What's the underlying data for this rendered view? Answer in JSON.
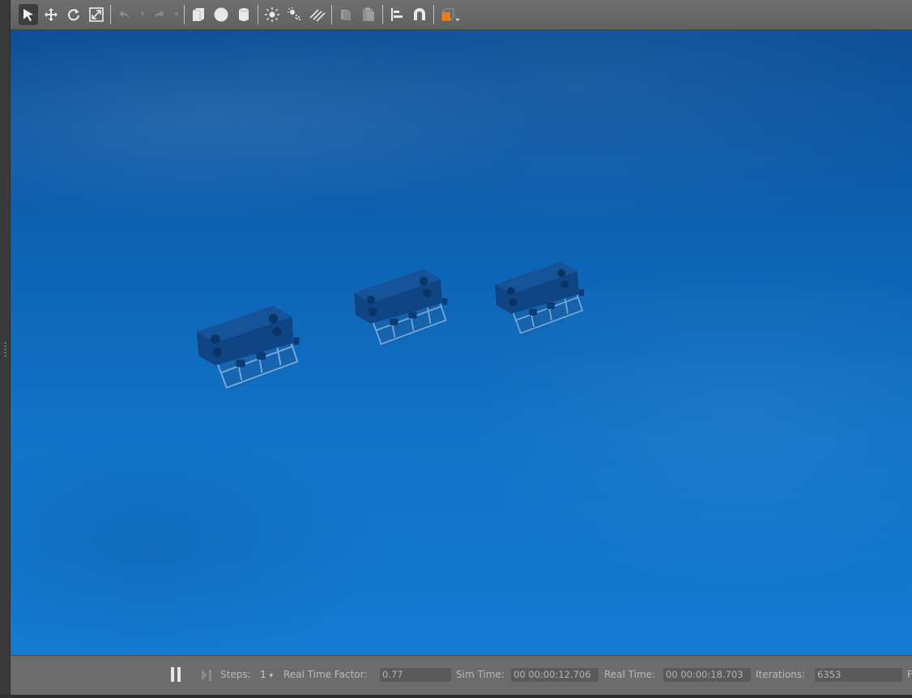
{
  "toolbar": {
    "icons": [
      "select-arrow-icon",
      "translate-icon",
      "rotate-icon",
      "scale-icon",
      "undo-icon",
      "undo-dropdown-icon",
      "redo-icon",
      "redo-dropdown-icon",
      "box-icon",
      "sphere-icon",
      "cylinder-icon",
      "point-light-icon",
      "spot-light-icon",
      "directional-light-icon",
      "copy-icon",
      "paste-icon",
      "align-icon",
      "snap-icon",
      "view-angle-icon"
    ],
    "accent_color": "#f07c14"
  },
  "viewport": {
    "models": [
      "model-1",
      "model-2",
      "model-3"
    ],
    "water_color": "#0e63b4"
  },
  "statusbar": {
    "steps_label": "Steps:",
    "steps_value": "1",
    "rtf_label": "Real Time Factor:",
    "rtf_value": "0.77",
    "sim_time_label": "Sim Time:",
    "sim_time_value": "00 00:00:12.706",
    "real_time_label": "Real Time:",
    "real_time_value": "00 00:00:18.703",
    "iterations_label": "Iterations:",
    "iterations_value": "6353",
    "trailing_label": "F"
  }
}
